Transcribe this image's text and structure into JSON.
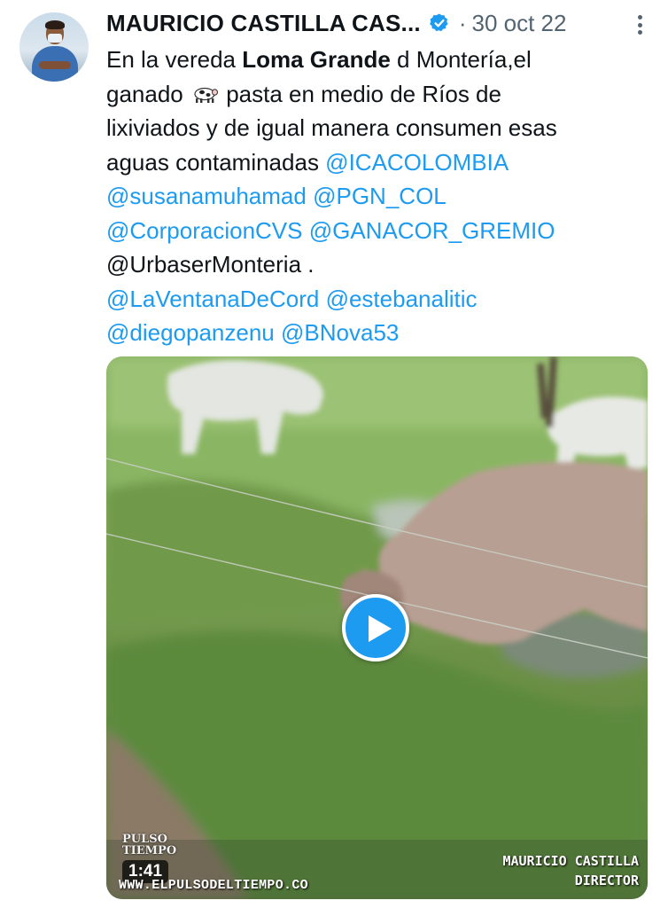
{
  "tweet": {
    "author_name": "MAURICIO CASTILLA CAS...",
    "separator": "·",
    "date": "30 oct 22",
    "lines": [
      {
        "parts": [
          {
            "t": "En la vereda "
          },
          {
            "t": "Loma Grande",
            "s": "bold"
          },
          {
            "t": " d Montería,el"
          }
        ]
      },
      {
        "parts": [
          {
            "t": "ganado "
          },
          {
            "t": "cow-emoji",
            "s": "icon"
          },
          {
            "t": " pasta en medio de Ríos de"
          }
        ]
      },
      {
        "parts": [
          {
            "t": "lixiviados y de igual manera consumen esas"
          }
        ]
      },
      {
        "parts": [
          {
            "t": "aguas contaminadas "
          },
          {
            "t": "@ICACOLOMBIA",
            "s": "mention"
          }
        ]
      },
      {
        "parts": [
          {
            "t": "@susanamuhamad",
            "s": "mention"
          },
          {
            "t": " "
          },
          {
            "t": "@PGN_COL",
            "s": "mention"
          }
        ]
      },
      {
        "parts": [
          {
            "t": "@CorporacionCVS",
            "s": "mention"
          },
          {
            "t": " "
          },
          {
            "t": "@GANACOR_GREMIO",
            "s": "mention"
          }
        ]
      },
      {
        "parts": [
          {
            "t": "@UrbaserMonteria ."
          }
        ]
      },
      {
        "parts": [
          {
            "t": "@LaVentanaDeCord",
            "s": "mention"
          },
          {
            "t": " "
          },
          {
            "t": "@estebanalitic",
            "s": "mention"
          }
        ]
      },
      {
        "parts": [
          {
            "t": "@diegopanzenu",
            "s": "mention"
          },
          {
            "t": " "
          },
          {
            "t": "@BNova53",
            "s": "mention"
          }
        ]
      }
    ]
  },
  "video": {
    "duration": "1:41",
    "watermark_logo_line1": "PULSO",
    "watermark_logo_line2": "TIEMPO",
    "watermark_url": "WWW.ELPULSODELTIEMPO.CO",
    "credit_name": "MAURICIO CASTILLA",
    "credit_title": "DIRECTOR"
  },
  "colors": {
    "mention": "#1d9bf0",
    "verified_badge": "#1d9bf0",
    "secondary_text": "#536471",
    "play_button": "#1d9bf0"
  },
  "icons": {
    "verified": "verified-badge-icon",
    "more": "more-options-icon",
    "play": "play-icon",
    "emoji": "cow-emoji"
  }
}
